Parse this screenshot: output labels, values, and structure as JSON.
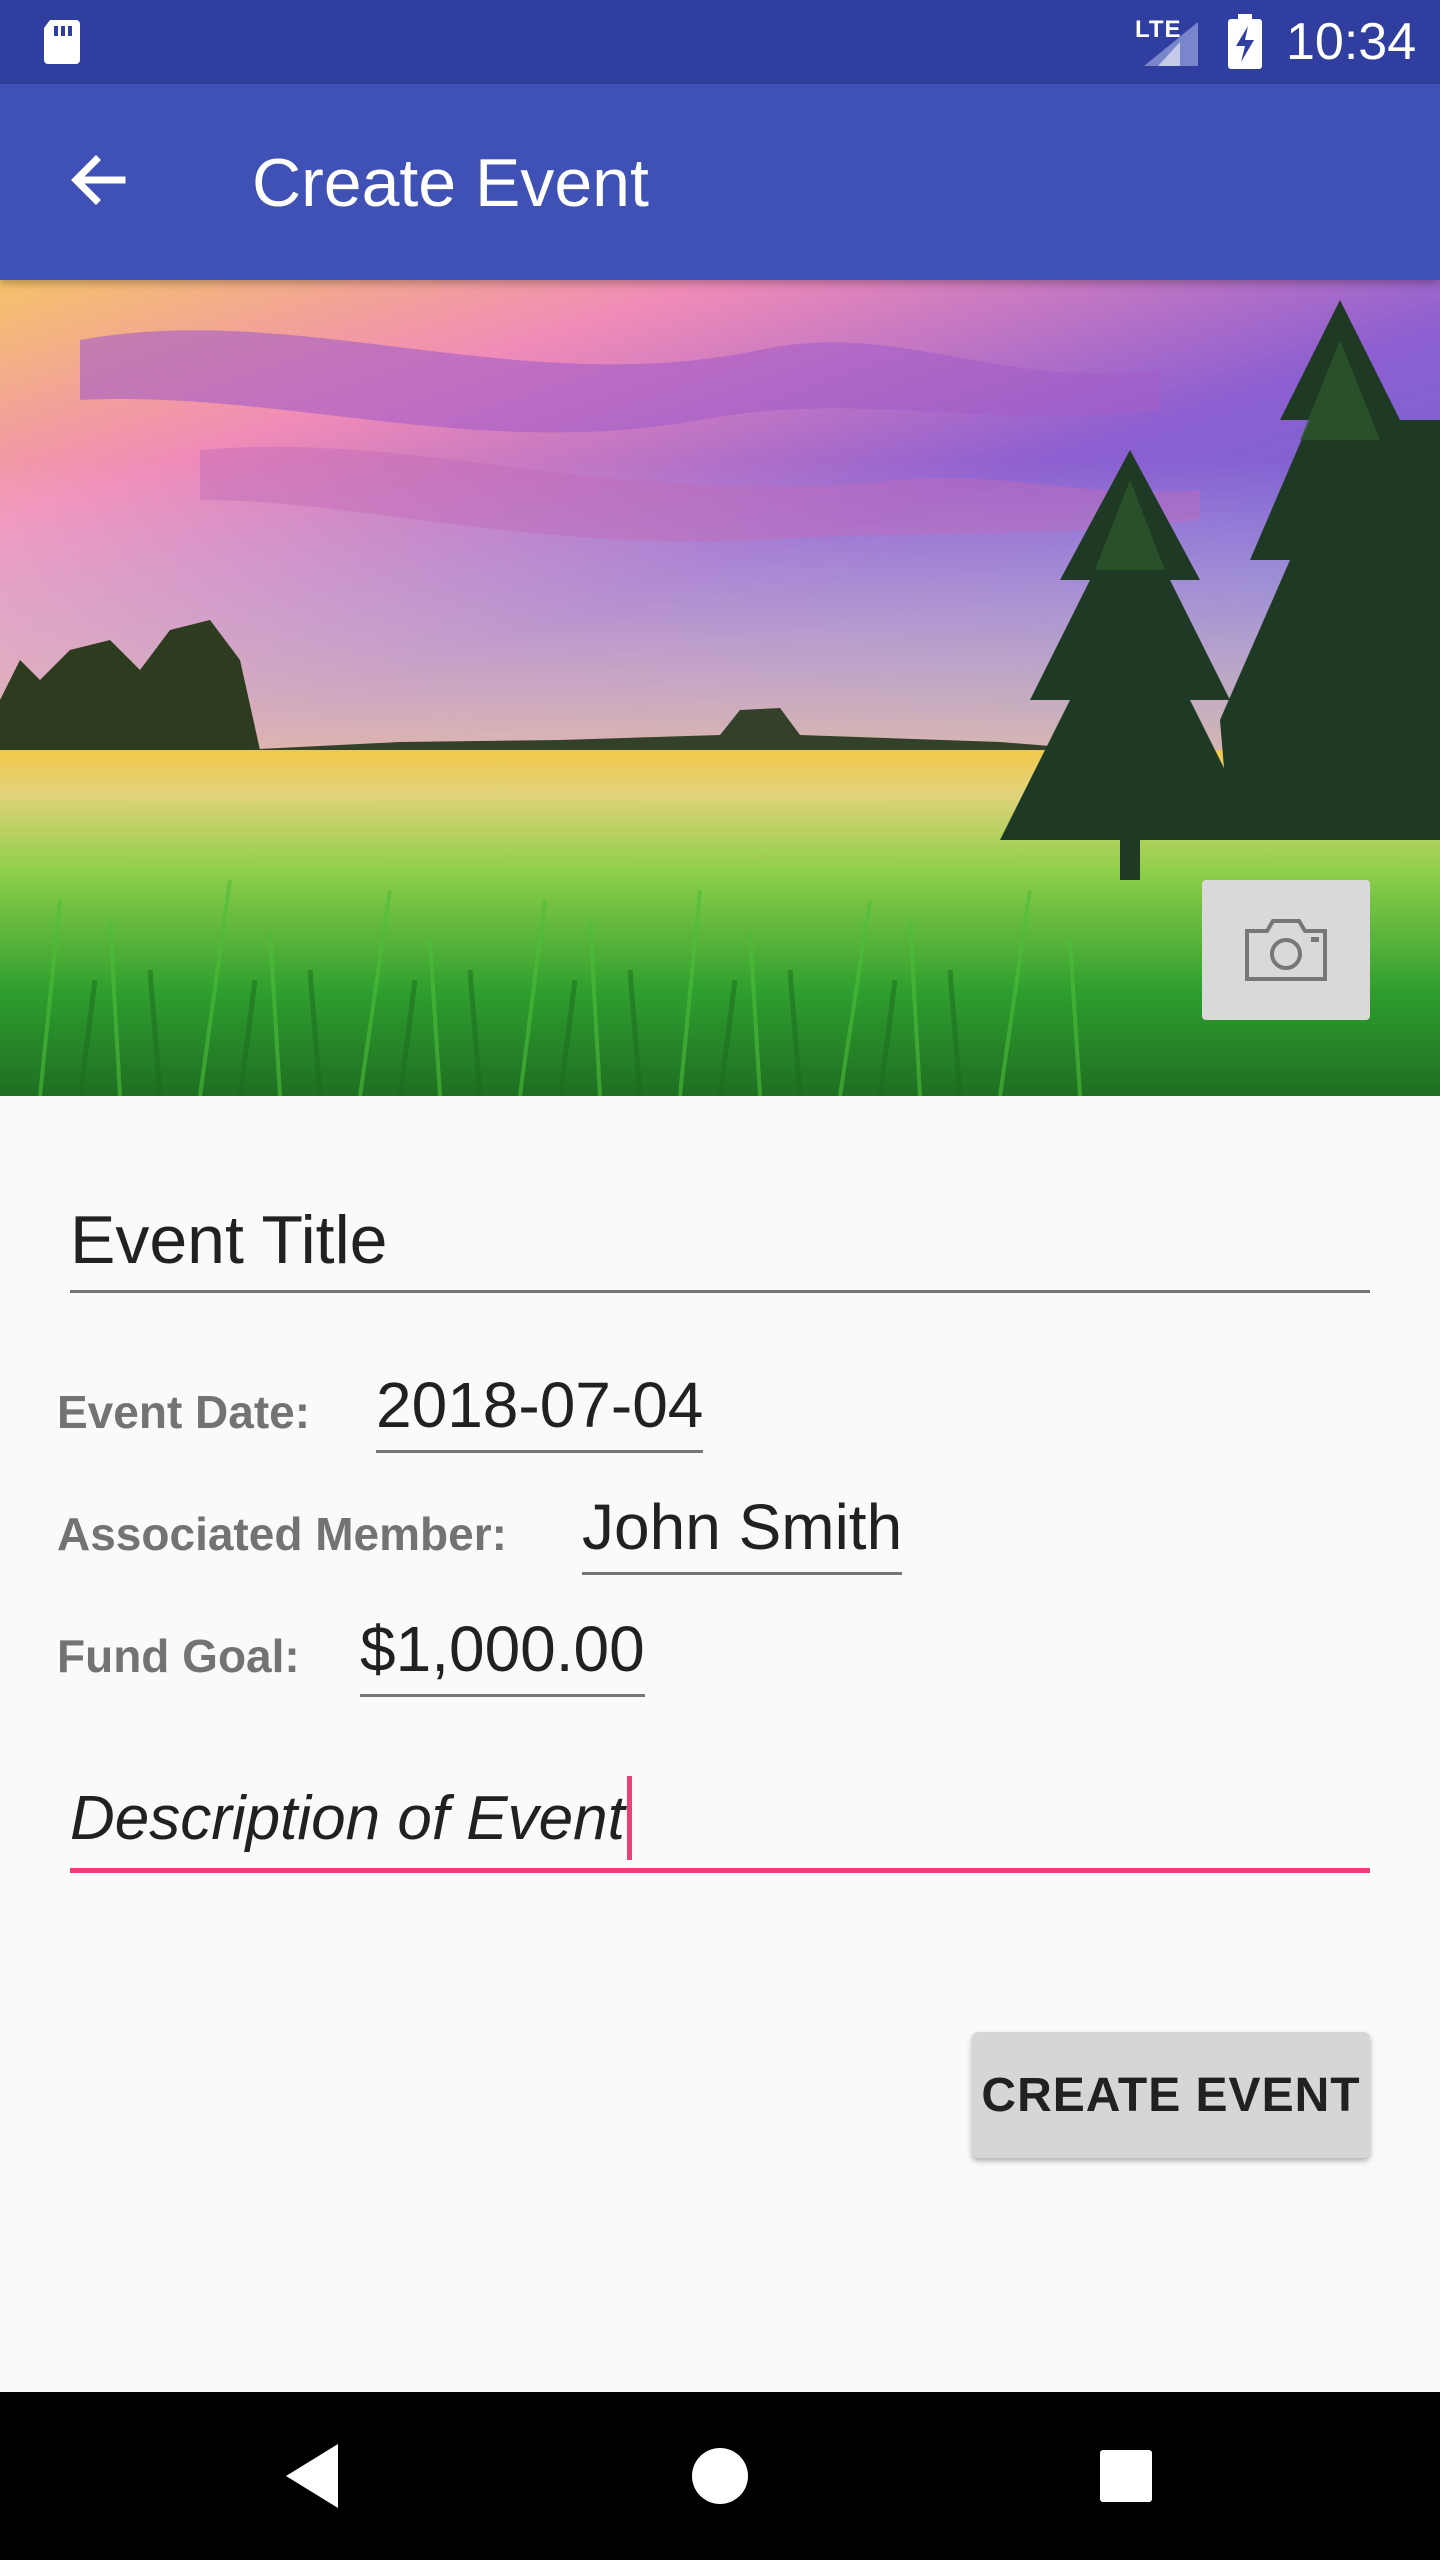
{
  "status_bar": {
    "network_label": "LTE",
    "time": "10:34",
    "icons": [
      "sd-card-icon",
      "signal-icon",
      "battery-charging-icon"
    ]
  },
  "app_bar": {
    "title": "Create Event",
    "back_icon": "arrow-back-icon"
  },
  "hero": {
    "image_subject": "landscape photo of a grass field with pine trees under a pink and purple sunset sky",
    "camera_icon": "camera-icon"
  },
  "form": {
    "title_field": {
      "value": "Event Title"
    },
    "event_date": {
      "label": "Event Date:",
      "value": "2018-07-04"
    },
    "associated_member": {
      "label": "Associated Member:",
      "value": "John Smith"
    },
    "fund_goal": {
      "label": "Fund Goal:",
      "value": "$1,000.00"
    },
    "description": {
      "value": "Description of Event"
    },
    "submit_label": "CREATE EVENT"
  },
  "nav_bar": {
    "icons": [
      "back-triangle-icon",
      "home-circle-icon",
      "recents-square-icon"
    ]
  },
  "colors": {
    "status_bar": "#303f9f",
    "primary": "#3f51b5",
    "accent": "#ec407a",
    "background": "#fafafa"
  }
}
